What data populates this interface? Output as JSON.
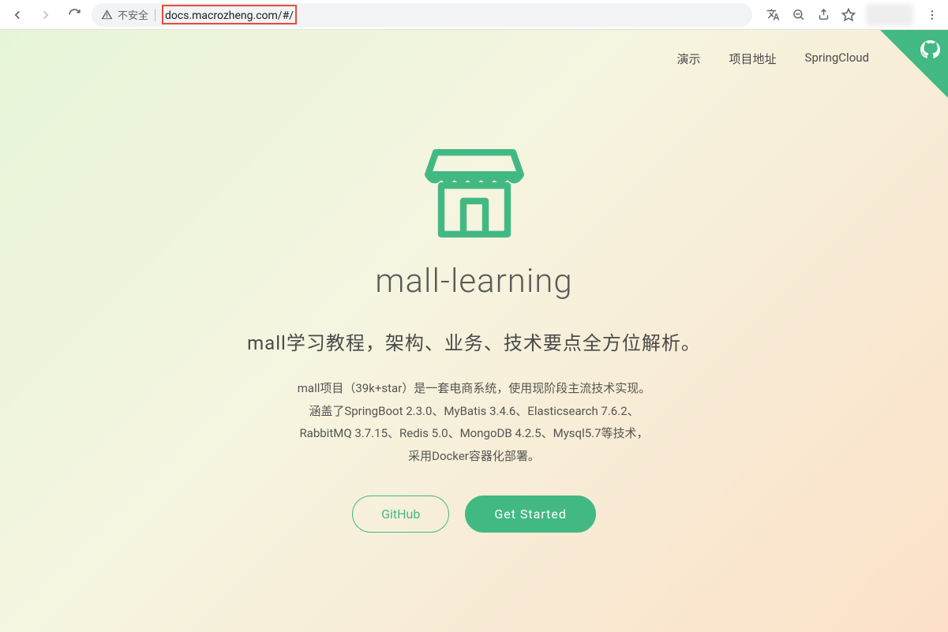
{
  "browser": {
    "security_label": "不安全",
    "url": "docs.macrozheng.com/#/"
  },
  "nav": {
    "items": [
      "演示",
      "项目地址",
      "SpringCloud"
    ]
  },
  "hero": {
    "title": "mall-learning",
    "subtitle": "mall学习教程，架构、业务、技术要点全方位解析。",
    "desc_line1": "mall项目（39k+star）是一套电商系统，使用现阶段主流技术实现。",
    "desc_line2": "涵盖了SpringBoot 2.3.0、MyBatis 3.4.6、Elasticsearch 7.6.2、",
    "desc_line3": "RabbitMQ 3.7.15、Redis 5.0、MongoDB 4.2.5、Mysql5.7等技术，",
    "desc_line4": "采用Docker容器化部署。",
    "button_github": "GitHub",
    "button_start": "Get Started"
  }
}
